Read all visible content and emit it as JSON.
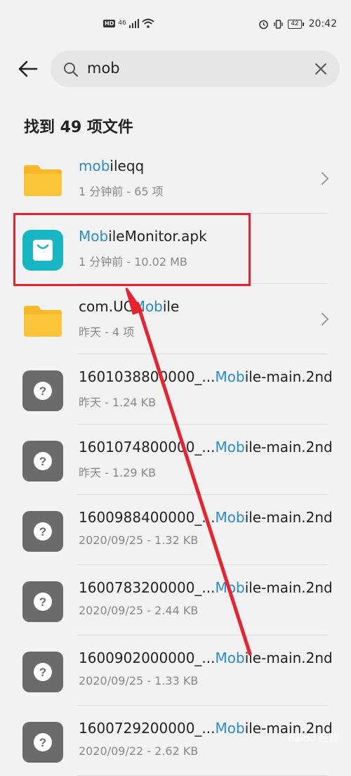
{
  "status": {
    "left_indicators": [
      "HD",
      "46",
      "signal",
      "wifi"
    ],
    "battery": "42",
    "time": "20:42"
  },
  "search": {
    "query": "mob"
  },
  "result_summary": "找到 49 项文件",
  "files": [
    {
      "icon": "folder-icon",
      "name_pre": "",
      "name_hl": "mob",
      "name_post": "ileqq",
      "meta": "1 分钟前 - 65 项",
      "chevron": true
    },
    {
      "icon": "apk-icon",
      "name_pre": "",
      "name_hl": "Mob",
      "name_post": "ileMonitor.apk",
      "meta": "1 分钟前 - 10.02 MB",
      "chevron": false
    },
    {
      "icon": "folder-icon",
      "name_pre": "com.UC",
      "name_hl": "Mob",
      "name_post": "ile",
      "meta": "昨天 - 4 项",
      "chevron": true
    },
    {
      "icon": "unknown-file-icon",
      "name_pre": "1601038800000_...",
      "name_hl": "Mob",
      "name_post": "ile-main.2nd",
      "meta": "昨天 - 1.24 KB",
      "chevron": false
    },
    {
      "icon": "unknown-file-icon",
      "name_pre": "1601074800000_...",
      "name_hl": "Mob",
      "name_post": "ile-main.2nd",
      "meta": "昨天 - 1.29 KB",
      "chevron": false
    },
    {
      "icon": "unknown-file-icon",
      "name_pre": "1600988400000_...",
      "name_hl": "Mob",
      "name_post": "ile-main.2nd",
      "meta": "2020/09/25 - 1.32 KB",
      "chevron": false
    },
    {
      "icon": "unknown-file-icon",
      "name_pre": "1600783200000_...",
      "name_hl": "Mob",
      "name_post": "ile-main.2nd",
      "meta": "2020/09/25 - 2.44 KB",
      "chevron": false
    },
    {
      "icon": "unknown-file-icon",
      "name_pre": "1600902000000_...",
      "name_hl": "Mob",
      "name_post": "ile-main.2nd",
      "meta": "2020/09/25 - 1.33 KB",
      "chevron": false
    },
    {
      "icon": "unknown-file-icon",
      "name_pre": "1600729200000_...",
      "name_hl": "Mob",
      "name_post": "ile-main.2nd",
      "meta": "2020/09/22 - 2.62 KB",
      "chevron": false
    }
  ],
  "colors": {
    "highlight": "#2a8ccf",
    "folder": "#f7b928",
    "apk": "#17b6c5",
    "unknown": "#6b6b6b",
    "annotation": "#e8232f"
  },
  "watermark": "Baidu 经验"
}
